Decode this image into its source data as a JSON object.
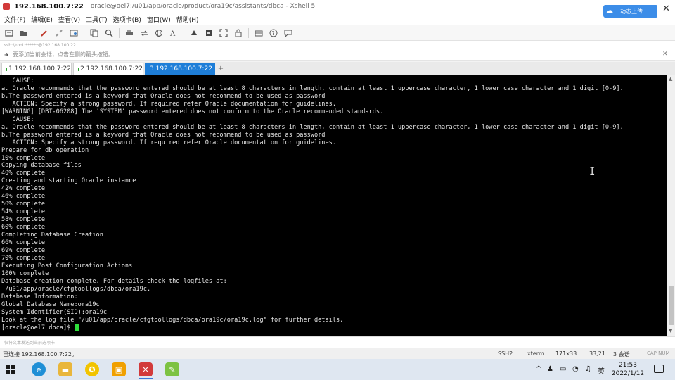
{
  "window": {
    "host_title": "192.168.100.7:22",
    "path_title": "oracle@oel7:/u01/app/oracle/product/ora19c/assistants/dbca - Xshell 5",
    "upload_label": "动态上传",
    "close_glyph": "✕"
  },
  "menu": {
    "items": [
      "文件(F)",
      "编辑(E)",
      "查看(V)",
      "工具(T)",
      "选项卡(B)",
      "窗口(W)",
      "帮助(H)"
    ]
  },
  "toolbar": {
    "icons": [
      "new-session-icon",
      "open-folder-icon",
      "connect-icon",
      "disconnect-icon",
      "properties-icon",
      "copy-icon",
      "find-icon",
      "print-icon",
      "transfer-icon",
      "globe-icon",
      "font-icon",
      "keyboard-icon",
      "script-icon",
      "fullscreen-icon",
      "lock-icon",
      "compose-icon",
      "help-icon",
      "chat-icon"
    ]
  },
  "address": {
    "text": "ssh://root:******@192.168.100.22"
  },
  "hint": {
    "text": "要添加当前会话，点击左侧的箭头按钮。",
    "close_glyph": "✕"
  },
  "tabs": [
    {
      "label": "1 192.168.100.7:22",
      "active": false,
      "connected": true
    },
    {
      "label": "2 192.168.100.7:22",
      "active": false,
      "connected": true
    },
    {
      "label": "3 192.168.100.7:22",
      "active": true,
      "connected": true
    }
  ],
  "tab_add_glyph": "+",
  "terminal": {
    "lines": [
      "   CAUSE:",
      "a. Oracle recommends that the password entered should be at least 8 characters in length, contain at least 1 uppercase character, 1 lower case character and 1 digit [0-9].",
      "b.The password entered is a keyword that Oracle does not recommend to be used as password",
      "   ACTION: Specify a strong password. If required refer Oracle documentation for guidelines.",
      "[WARNING] [DBT-06208] The 'SYSTEM' password entered does not conform to the Oracle recommended standards.",
      "   CAUSE:",
      "a. Oracle recommends that the password entered should be at least 8 characters in length, contain at least 1 uppercase character, 1 lower case character and 1 digit [0-9].",
      "b.The password entered is a keyword that Oracle does not recommend to be used as password",
      "   ACTION: Specify a strong password. If required refer Oracle documentation for guidelines.",
      "Prepare for db operation",
      "10% complete",
      "Copying database files",
      "40% complete",
      "Creating and starting Oracle instance",
      "42% complete",
      "46% complete",
      "50% complete",
      "54% complete",
      "58% complete",
      "60% complete",
      "Completing Database Creation",
      "66% complete",
      "69% complete",
      "70% complete",
      "Executing Post Configuration Actions",
      "100% complete",
      "Database creation complete. For details check the logfiles at:",
      " /u01/app/oracle/cfgtoollogs/dbca/ora19c.",
      "Database Information:",
      "Global Database Name:ora19c",
      "System Identifier(SID):ora19c",
      "Look at the log file \"/u01/app/oracle/cfgtoollogs/dbca/ora19c/ora19c.log\" for further details."
    ],
    "prompt": "[oracle@oel7 dbca]$ ",
    "cursor_color": "#2ee03a"
  },
  "compose": {
    "placeholder": "仅将文本发送到当前选项卡"
  },
  "status": {
    "connection": "已连接 192.168.100.7:22。",
    "protocol": "SSH2",
    "terminal_type": "xterm",
    "size": "171x33",
    "position": "33,21",
    "sessions": "3 会话",
    "caps": "CAP NUM"
  },
  "taskbar": {
    "apps": [
      "edge-icon",
      "file-explorer-icon",
      "app-icon-yellow",
      "app-icon-orange",
      "xshell-icon",
      "app-icon-green"
    ],
    "tray_chevron": "^",
    "ime": "英",
    "time": "21:53",
    "date": "2022/1/12"
  },
  "colors": {
    "active_tab": "#1e7ed8",
    "terminal_bg": "#000000",
    "terminal_fg": "#e4e4e4",
    "upload_button": "#3c8de8"
  }
}
